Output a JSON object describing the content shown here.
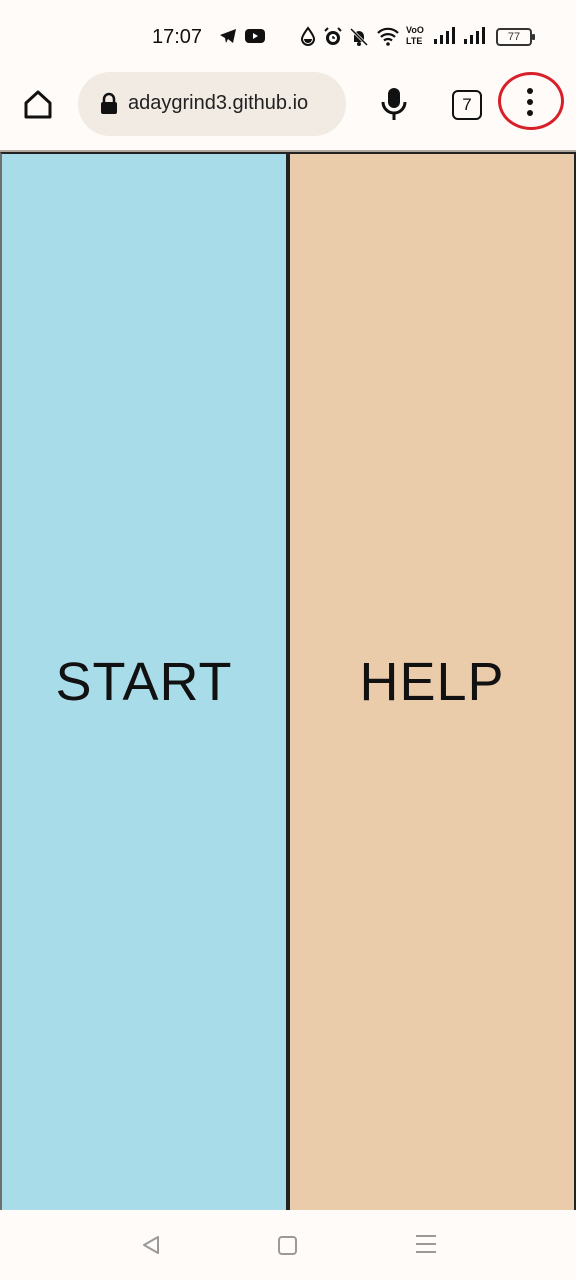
{
  "status_bar": {
    "time": "17:07",
    "battery": "77",
    "icons": [
      "telegram-icon",
      "youtube-icon",
      "water-drop-icon",
      "alarm-icon",
      "mute-bell-icon",
      "wifi-icon",
      "volte-icon",
      "signal-icon",
      "signal-icon",
      "battery-icon"
    ]
  },
  "toolbar": {
    "url": "adaygrind3.github.io",
    "tab_count": "7",
    "highlight_color": "#d8202a"
  },
  "panels": {
    "start_label": "START",
    "help_label": "HELP",
    "start_color": "#a8dce9",
    "help_color": "#eaccaa"
  },
  "nav_bar": {
    "icons": [
      "back-icon",
      "home-square-icon",
      "recents-icon"
    ]
  }
}
